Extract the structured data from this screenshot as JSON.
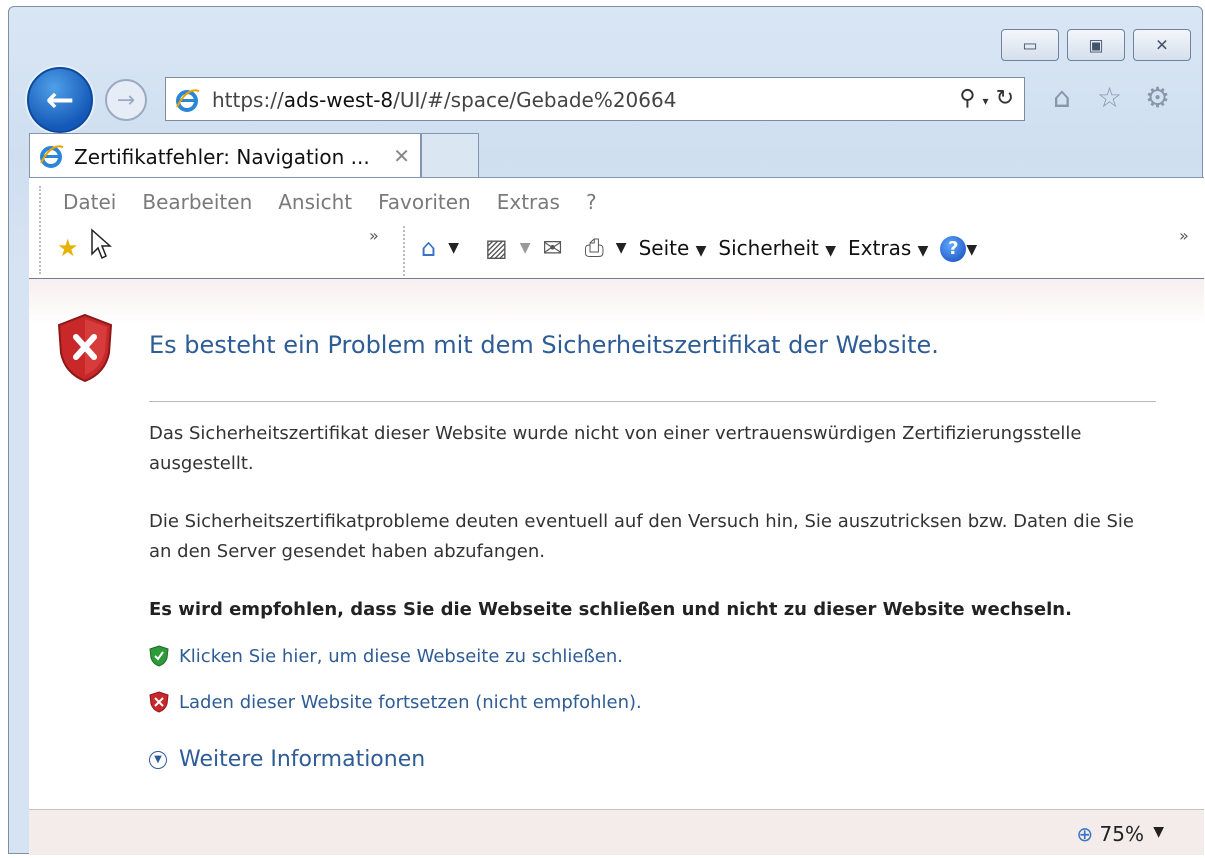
{
  "window": {
    "caption_buttons": [
      "minimize-icon",
      "maximize-icon",
      "close-icon"
    ]
  },
  "nav": {
    "address_prefix": "https://",
    "address_host": "ads-west-8",
    "address_path": "/UI/#/space/Gebade%20664"
  },
  "tabs": [
    {
      "label": "Zertifikatfehler: Navigation ...",
      "close": "✕"
    }
  ],
  "menubar": {
    "items": [
      "Datei",
      "Bearbeiten",
      "Ansicht",
      "Favoriten",
      "Extras",
      "?"
    ]
  },
  "commandbar": {
    "seite": "Seite",
    "sicherheit": "Sicherheit",
    "extras": "Extras"
  },
  "content": {
    "heading": "Es besteht ein Problem mit dem Sicherheitszertifikat der Website.",
    "para1": "Das Sicherheitszertifikat dieser Website wurde nicht von einer vertrauenswürdigen Zertifizierungsstelle ausgestellt.",
    "para2": "Die Sicherheitszertifikatprobleme deuten eventuell auf den Versuch hin, Sie auszutricksen bzw. Daten die Sie an den Server gesendet haben abzufangen.",
    "recommendation": "Es wird empfohlen, dass Sie die Webseite schließen und nicht zu dieser Website wechseln.",
    "link_close": "Klicken Sie hier, um diese Webseite zu schließen.",
    "link_continue": "Laden dieser Website fortsetzen (nicht empfohlen).",
    "more_info": "Weitere Informationen"
  },
  "status": {
    "zoom": "75%"
  },
  "colors": {
    "link": "#2e5c96",
    "back_button": "#1559b8",
    "error_shield": "#c8282a",
    "ok_shield": "#2e9a3a"
  }
}
